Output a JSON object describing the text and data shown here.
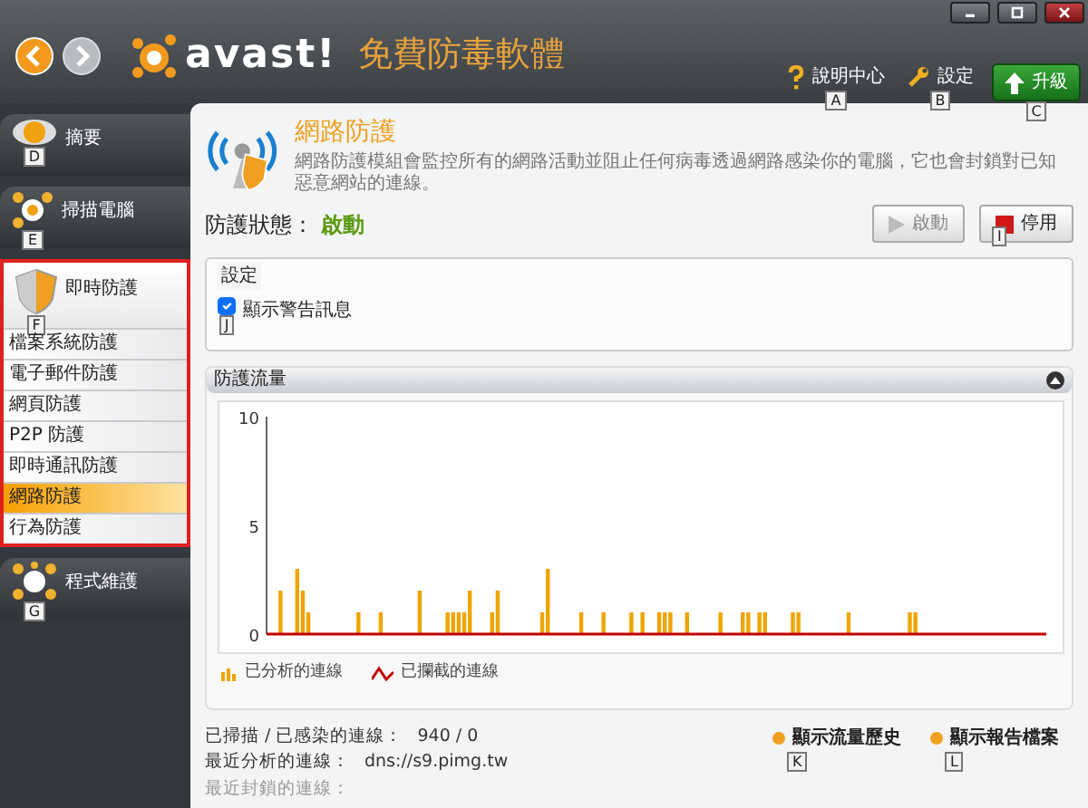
{
  "header": {
    "logo": "avast!",
    "product": "免費防毒軟體",
    "links": [
      {
        "kind": "help",
        "label": "說明中心",
        "shortcut": "A"
      },
      {
        "kind": "settings",
        "label": "設定",
        "shortcut": "B"
      },
      {
        "kind": "upgrade",
        "label": "升級",
        "shortcut": "C"
      }
    ]
  },
  "sidebar": {
    "items": [
      {
        "kind": "summary",
        "label": "摘要",
        "shortcut": "D",
        "expanded": false
      },
      {
        "kind": "scan",
        "label": "掃描電腦",
        "shortcut": "E",
        "expanded": false
      },
      {
        "kind": "shield",
        "label": "即時防護",
        "shortcut": "F",
        "expanded": true,
        "children": [
          {
            "label": "檔案系統防護",
            "selected": false
          },
          {
            "label": "電子郵件防護",
            "selected": false
          },
          {
            "label": "網頁防護",
            "selected": false
          },
          {
            "label": "P2P 防護",
            "selected": false
          },
          {
            "label": "即時通訊防護",
            "selected": false
          },
          {
            "label": "網路防護",
            "selected": true
          },
          {
            "label": "行為防護",
            "selected": false
          }
        ]
      },
      {
        "kind": "maintenance",
        "label": "程式維護",
        "shortcut": "G",
        "expanded": false
      }
    ]
  },
  "page": {
    "title": "網路防護",
    "description": "網路防護模組會監控所有的網路活動並阻止任何病毒透過網路感染你的電腦，它也會封鎖對已知惡意網站的連線。",
    "status_label": "防護狀態：",
    "status_value": "啟動",
    "buttons": [
      {
        "kind": "start",
        "label": "啟動",
        "disabled": true
      },
      {
        "kind": "stop",
        "label": "停用",
        "disabled": false,
        "shortcut": "I"
      }
    ],
    "settings": {
      "legend": "設定",
      "options": [
        {
          "label": "顯示警告訊息",
          "checked": true,
          "shortcut": "J"
        }
      ]
    },
    "traffic": {
      "title": "防護流量",
      "expanded": true,
      "chart_data": {
        "type": "bar",
        "ylim": [
          0,
          10
        ],
        "yticks": [
          0,
          5,
          10
        ],
        "series": [
          {
            "name": "已分析的連線",
            "color": "#f0a400",
            "values": [
              0,
              0,
              2,
              0,
              0,
              3,
              2,
              1,
              0,
              0,
              0,
              0,
              0,
              0,
              0,
              0,
              1,
              0,
              0,
              0,
              1,
              0,
              0,
              0,
              0,
              0,
              0,
              2,
              0,
              0,
              0,
              0,
              1,
              1,
              1,
              1,
              2,
              0,
              0,
              0,
              1,
              2,
              0,
              0,
              0,
              0,
              0,
              0,
              0,
              1,
              3,
              0,
              0,
              0,
              0,
              0,
              1,
              0,
              0,
              0,
              1,
              0,
              0,
              0,
              0,
              1,
              0,
              1,
              0,
              0,
              1,
              1,
              1,
              0,
              0,
              1,
              0,
              0,
              0,
              0,
              0,
              1,
              0,
              0,
              0,
              1,
              1,
              0,
              1,
              1,
              0,
              0,
              0,
              0,
              1,
              1,
              0,
              0,
              0,
              0,
              0,
              0,
              0,
              0,
              1,
              0,
              0,
              0,
              0,
              0,
              0,
              0,
              0,
              0,
              0,
              1,
              1,
              0,
              0,
              0,
              0,
              0,
              0,
              0,
              0,
              0,
              0,
              0,
              0,
              0,
              0,
              0,
              0,
              0,
              0,
              0,
              0,
              0,
              0,
              0
            ]
          },
          {
            "name": "已攔截的連線",
            "color": "#c00000",
            "values": [
              0,
              0,
              0,
              0,
              0,
              0,
              0,
              0,
              0,
              0,
              0,
              0,
              0,
              0,
              0,
              0,
              0,
              0,
              0,
              0,
              0,
              0,
              0,
              0,
              0,
              0,
              0,
              0,
              0,
              0,
              0,
              0,
              0,
              0,
              0,
              0,
              0,
              0,
              0,
              0,
              0,
              0,
              0,
              0,
              0,
              0,
              0,
              0,
              0,
              0,
              0,
              0,
              0,
              0,
              0,
              0,
              0,
              0,
              0,
              0,
              0,
              0,
              0,
              0,
              0,
              0,
              0,
              0,
              0,
              0,
              0,
              0,
              0,
              0,
              0,
              0,
              0,
              0,
              0,
              0,
              0,
              0,
              0,
              0,
              0,
              0,
              0,
              0,
              0,
              0,
              0,
              0,
              0,
              0,
              0,
              0,
              0,
              0,
              0,
              0,
              0,
              0,
              0,
              0,
              0,
              0,
              0,
              0,
              0,
              0,
              0,
              0,
              0,
              0,
              0,
              0,
              0,
              0,
              0,
              0,
              0,
              0,
              0,
              0,
              0,
              0,
              0,
              0,
              0,
              0,
              0,
              0,
              0,
              0,
              0,
              0,
              0,
              0,
              0,
              0
            ]
          }
        ]
      }
    },
    "stats": [
      {
        "label": "已掃描 / 已感染的連線：",
        "value": "940 / 0",
        "disabled": false
      },
      {
        "label": "最近分析的連線：",
        "value": "dns://s9.pimg.tw",
        "disabled": false
      },
      {
        "label": "最近封鎖的連線：",
        "disabled": true
      }
    ],
    "links": [
      {
        "label": "顯示流量歷史",
        "shortcut": "K"
      },
      {
        "label": "顯示報告檔案",
        "shortcut": "L"
      }
    ]
  }
}
